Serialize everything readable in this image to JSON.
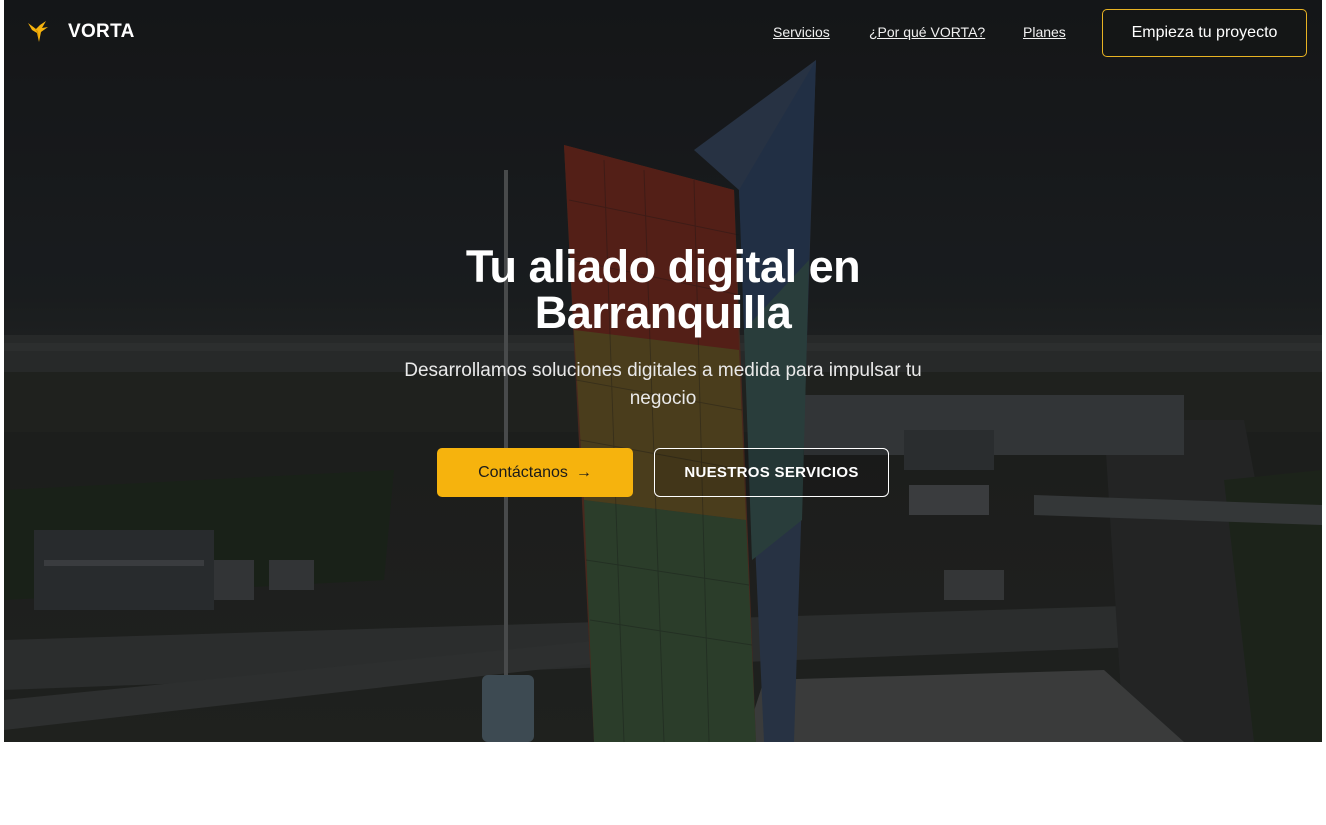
{
  "brand": {
    "name": "VORTA",
    "logo_icon": "hummingbird-icon",
    "accent": "#f6b30d"
  },
  "nav": {
    "links": [
      "Servicios",
      "¿Por qué VORTA?",
      "Planes"
    ],
    "cta": "Empieza tu proyecto"
  },
  "hero": {
    "title_line1": "Tu aliado digital en",
    "title_line2": "Barranquilla",
    "subtitle_line1": "Desarrollamos soluciones digitales a medida para impulsar tu",
    "subtitle_line2": "negocio",
    "primary_button": "Contáctanos",
    "primary_button_icon": "arrow-right-icon",
    "secondary_button": "NUESTROS SERVICIOS"
  }
}
